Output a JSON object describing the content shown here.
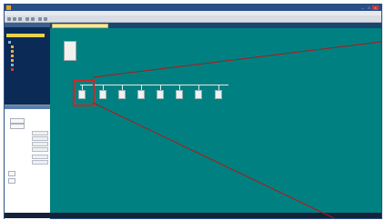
{
  "window": {
    "title": "",
    "controls": [
      "–",
      "□",
      "×"
    ]
  },
  "menubar": {
    "items": []
  },
  "project_pane": {
    "header": "",
    "tree": []
  },
  "properties_pane": {
    "rows": [],
    "buttons": []
  },
  "tab": {
    "label": ""
  },
  "canvas": {
    "network_label": "",
    "stations": [
      {
        "label": ""
      },
      {
        "label": ""
      },
      {
        "label": ""
      },
      {
        "label": ""
      },
      {
        "label": ""
      },
      {
        "label": ""
      },
      {
        "label": ""
      },
      {
        "label": ""
      }
    ],
    "highlight_color": "#dd2020"
  },
  "statusbar": {
    "text": ""
  },
  "colors": {
    "canvas_bg": "#008080",
    "tree_pane_bg": "#0b2a55",
    "tab_bg": "#f3e7a2",
    "callout_line": "#b01818"
  }
}
